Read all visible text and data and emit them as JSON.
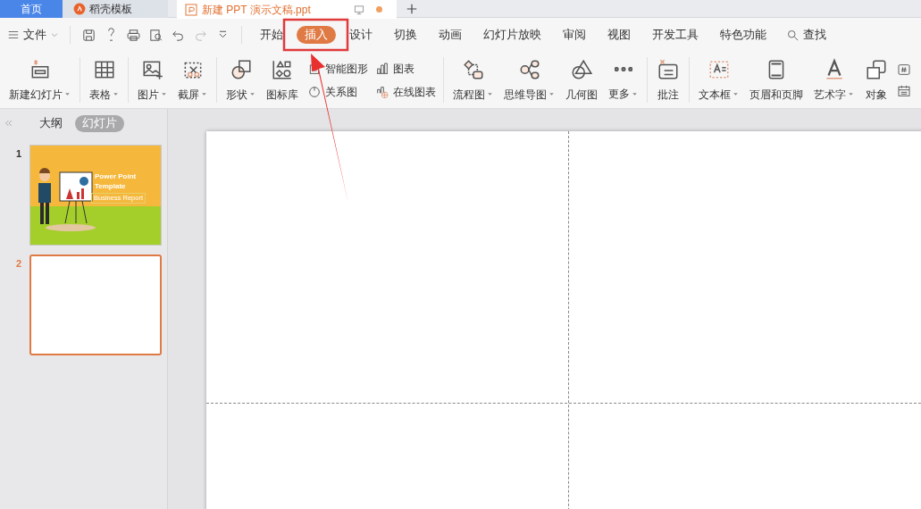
{
  "top_tabs": [
    {
      "label": "首页",
      "kind": "home",
      "selected": false
    },
    {
      "label": "稻壳模板",
      "kind": "template",
      "selected": false
    },
    {
      "label": "新建 PPT 演示文稿.ppt",
      "kind": "document",
      "selected": true,
      "modified": true
    }
  ],
  "menu": {
    "file_label": "文件",
    "tabs": [
      {
        "label": "开始",
        "selected": false
      },
      {
        "label": "插入",
        "selected": true
      },
      {
        "label": "设计",
        "selected": false
      },
      {
        "label": "切换",
        "selected": false
      },
      {
        "label": "动画",
        "selected": false
      },
      {
        "label": "幻灯片放映",
        "selected": false
      },
      {
        "label": "审阅",
        "selected": false
      },
      {
        "label": "视图",
        "selected": false
      },
      {
        "label": "开发工具",
        "selected": false
      },
      {
        "label": "特色功能",
        "selected": false
      }
    ],
    "search_label": "查找"
  },
  "ribbon": [
    {
      "items": [
        {
          "kind": "large",
          "label": "新建幻灯片",
          "dropdown": true
        }
      ]
    },
    {
      "items": [
        {
          "kind": "large",
          "label": "表格",
          "dropdown": true
        }
      ]
    },
    {
      "items": [
        {
          "kind": "large",
          "label": "图片",
          "dropdown": true
        },
        {
          "kind": "large",
          "label": "截屏",
          "dropdown": true
        }
      ]
    },
    {
      "items": [
        {
          "kind": "large",
          "label": "形状",
          "dropdown": true
        },
        {
          "kind": "large",
          "label": "图标库",
          "dropdown": false
        },
        {
          "kind": "stack",
          "items": [
            {
              "label": "智能图形"
            },
            {
              "label": "关系图"
            }
          ]
        },
        {
          "kind": "stack",
          "items": [
            {
              "label": "图表"
            },
            {
              "label": "在线图表"
            }
          ]
        }
      ]
    },
    {
      "items": [
        {
          "kind": "large",
          "label": "流程图",
          "dropdown": true
        },
        {
          "kind": "large",
          "label": "思维导图",
          "dropdown": true
        },
        {
          "kind": "large",
          "label": "几何图",
          "dropdown": false
        },
        {
          "kind": "large",
          "label": "更多",
          "dropdown": true
        }
      ]
    },
    {
      "items": [
        {
          "kind": "large",
          "label": "批注",
          "dropdown": false
        }
      ]
    },
    {
      "items": [
        {
          "kind": "large",
          "label": "文本框",
          "dropdown": true
        },
        {
          "kind": "large",
          "label": "页眉和页脚",
          "dropdown": false
        },
        {
          "kind": "large",
          "label": "艺术字",
          "dropdown": true
        },
        {
          "kind": "large",
          "label": "对象",
          "dropdown": false
        },
        {
          "kind": "icons"
        }
      ]
    }
  ],
  "panel": {
    "tabs": [
      {
        "label": "大纲",
        "selected": false
      },
      {
        "label": "幻灯片",
        "selected": true
      }
    ],
    "slides": [
      {
        "number": "1",
        "kind": "title",
        "selected": false,
        "title": "Power Point Template",
        "subtitle": "Business Report"
      },
      {
        "number": "2",
        "kind": "blank",
        "selected": true
      }
    ]
  }
}
